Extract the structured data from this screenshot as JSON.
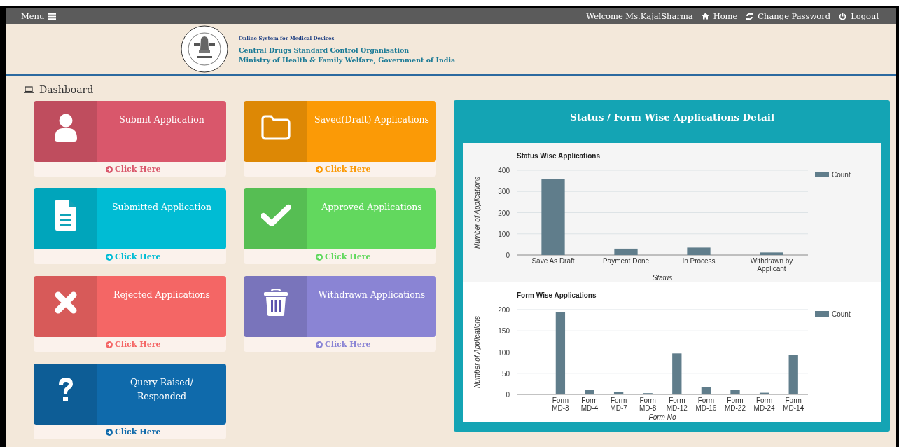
{
  "top_bar": {
    "menu_label": "Menu",
    "welcome": "Welcome Ms.KajalSharma",
    "links": [
      {
        "kind": "home",
        "label": "Home"
      },
      {
        "kind": "refresh",
        "label": "Change Password"
      },
      {
        "kind": "power",
        "label": "Logout"
      }
    ]
  },
  "header": {
    "system": "Online System for Medical Devices",
    "organisation": "Central Drugs Standard Control Organisation",
    "ministry": "Ministry of Health & Family Welfare, Government of India"
  },
  "page_title": "Dashboard",
  "tiles": [
    {
      "kind": "person",
      "title": "Submit Application",
      "link": "Click Here",
      "color": "#d9576b"
    },
    {
      "kind": "folder",
      "title": "Saved(Draft) Applications",
      "link": "Click Here",
      "color": "#fb9a06"
    },
    {
      "kind": "document",
      "title": "Submitted Application",
      "link": "Click Here",
      "color": "#00bcd4"
    },
    {
      "kind": "check",
      "title": "Approved Applications",
      "link": "Click Here",
      "color": "#62d85e"
    },
    {
      "kind": "cross",
      "title": "Rejected Applications",
      "link": "Click Here",
      "color": "#f46665"
    },
    {
      "kind": "trash",
      "title": "Withdrawn Applications",
      "link": "Click Here",
      "color": "#8a84d4"
    },
    {
      "kind": "question",
      "title": "Query Raised/ Responded",
      "link": "Click Here",
      "color": "#0f6aab"
    }
  ],
  "panel": {
    "title": "Status / Form Wise Applications Detail",
    "charts": [
      {
        "chart_data": {
          "type": "bar",
          "title": "Status Wise Applications",
          "xlabel": "Status",
          "ylabel": "Number of Applications",
          "categories": [
            "Save As Draft",
            "Payment Done",
            "In Process",
            "Withdrawn by Applicant"
          ],
          "series": [
            {
              "name": "Count",
              "color": "#607d8b",
              "values": [
                357,
                30,
                35,
                12
              ]
            }
          ],
          "ylim": [
            0,
            400
          ],
          "yticks": [
            0,
            100,
            200,
            300,
            400
          ],
          "grid": true
        }
      },
      {
        "chart_data": {
          "type": "bar",
          "title": "Form Wise Applications",
          "xlabel": "Form No",
          "ylabel": "Number of Applications",
          "categories": [
            null,
            "Form MD-3",
            "Form MD-4",
            "Form MD-7",
            "Form MD-8",
            "Form MD-12",
            "Form MD-16",
            "Form MD-22",
            "Form MD-24",
            "Form MD-14"
          ],
          "series": [
            {
              "name": "Count",
              "color": "#607d8b",
              "values": [
                null,
                195,
                10,
                6,
                3,
                97,
                18,
                11,
                4,
                93
              ]
            }
          ],
          "ylim": [
            0,
            200
          ],
          "yticks": [
            0,
            50,
            100,
            150,
            200
          ],
          "grid": true
        }
      }
    ]
  }
}
